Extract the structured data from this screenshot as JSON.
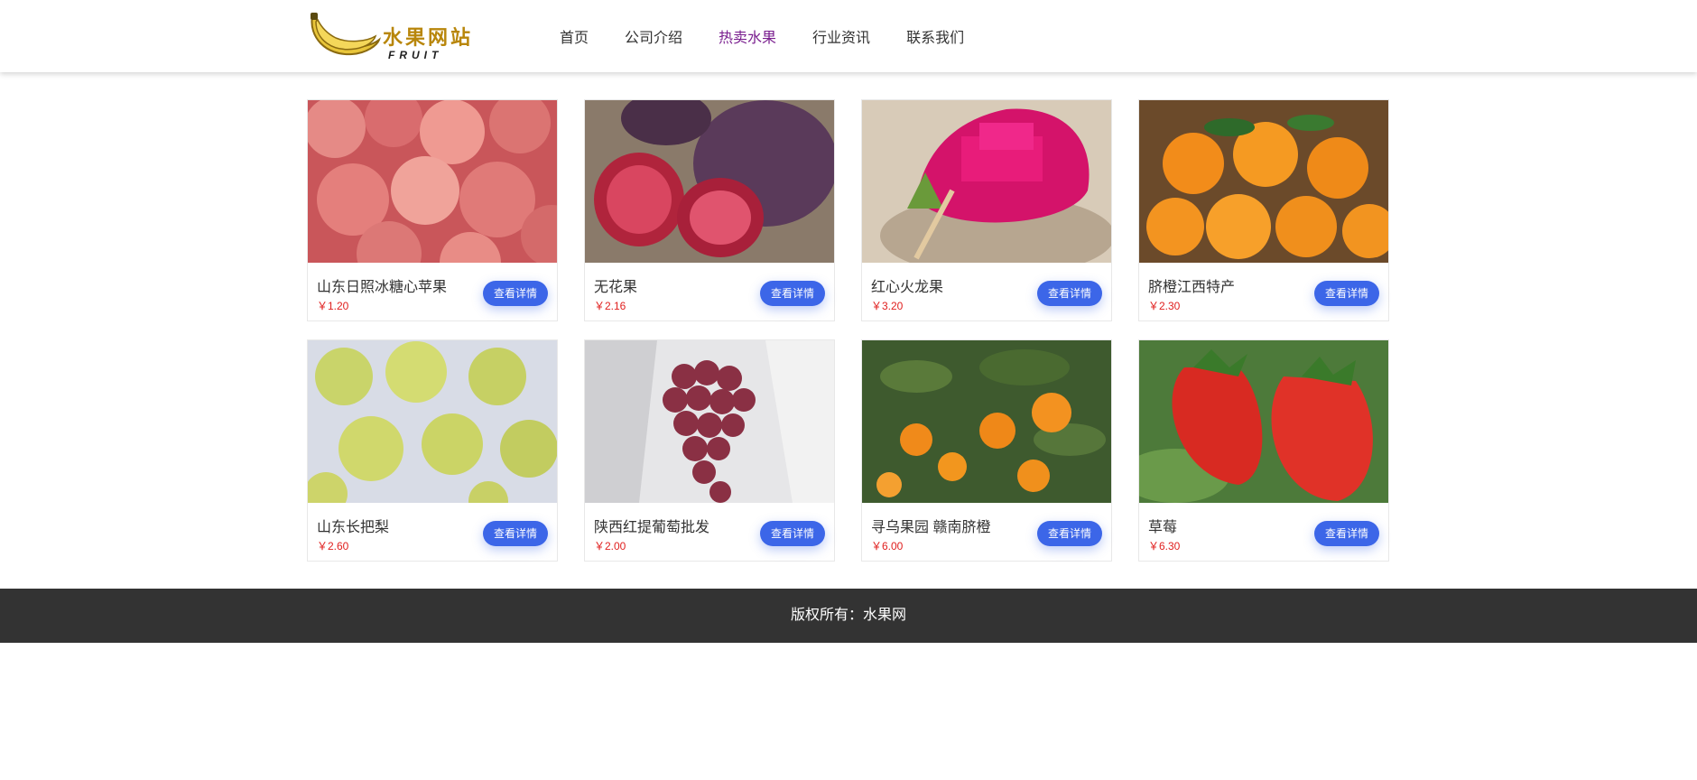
{
  "header": {
    "logo_text": "水果网站",
    "logo_sub": "FRUIT",
    "nav": [
      {
        "label": "首页",
        "active": false
      },
      {
        "label": "公司介绍",
        "active": false
      },
      {
        "label": "热卖水果",
        "active": true
      },
      {
        "label": "行业资讯",
        "active": false
      },
      {
        "label": "联系我们",
        "active": false
      }
    ]
  },
  "products": [
    {
      "name": "山东日照冰糖心苹果",
      "price": "￥1.20",
      "button": "查看详情"
    },
    {
      "name": "无花果",
      "price": "￥2.16",
      "button": "查看详情"
    },
    {
      "name": "红心火龙果",
      "price": "￥3.20",
      "button": "查看详情"
    },
    {
      "name": "脐橙江西特产",
      "price": "￥2.30",
      "button": "查看详情"
    },
    {
      "name": "山东长把梨",
      "price": "￥2.60",
      "button": "查看详情"
    },
    {
      "name": "陕西红提葡萄批发",
      "price": "￥2.00",
      "button": "查看详情"
    },
    {
      "name": "寻乌果园 赣南脐橙",
      "price": "￥6.00",
      "button": "查看详情"
    },
    {
      "name": "草莓",
      "price": "￥6.30",
      "button": "查看详情"
    }
  ],
  "footer": {
    "text": "版权所有：水果网"
  },
  "colors": {
    "accent": "#3c66e8",
    "price": "#e0201f",
    "active_nav": "#7a1f8f",
    "footer_bg": "#333333"
  }
}
